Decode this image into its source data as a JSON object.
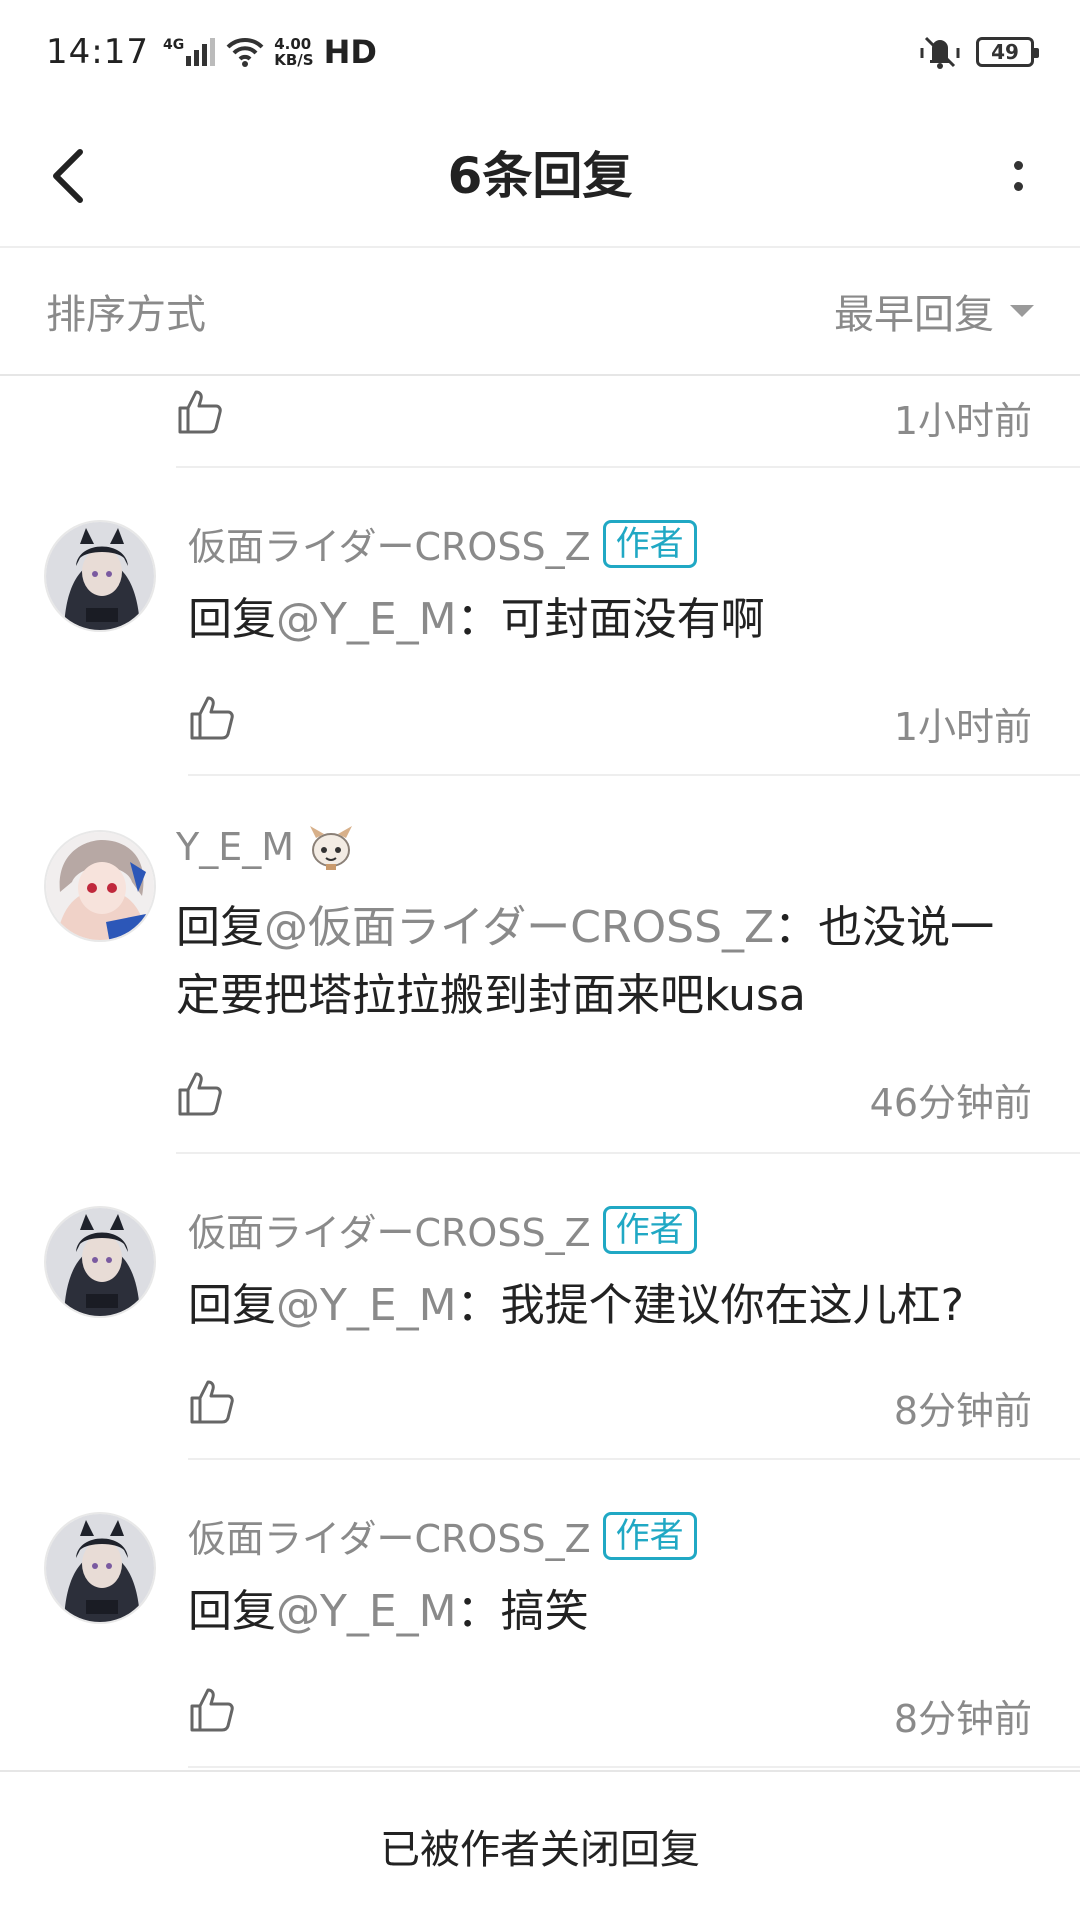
{
  "status_bar": {
    "time": "14:17",
    "network": "4G",
    "speed_value": "4.00",
    "speed_unit": "KB/S",
    "hd": "HD",
    "battery": "49"
  },
  "header": {
    "title": "6条回复"
  },
  "sort": {
    "label": "排序方式",
    "value": "最早回复"
  },
  "replies": [
    {
      "time": "1小时前"
    },
    {
      "username": "仮面ライダーCROSS_Z",
      "badge": "作者",
      "prefix": "回复",
      "mention": "@Y_E_M",
      "text": "：可封面没有啊",
      "time": "1小时前"
    },
    {
      "username": "Y_E_M",
      "prefix": "回复",
      "mention": "@仮面ライダーCROSS_Z",
      "text": "：也没说一定要把塔拉拉搬到封面来吧kusa",
      "time": "46分钟前"
    },
    {
      "username": "仮面ライダーCROSS_Z",
      "badge": "作者",
      "prefix": "回复",
      "mention": "@Y_E_M",
      "text": "：我提个建议你在这儿杠?",
      "time": "8分钟前"
    },
    {
      "username": "仮面ライダーCROSS_Z",
      "badge": "作者",
      "prefix": "回复",
      "mention": "@Y_E_M",
      "text": "：搞笑",
      "time": "8分钟前"
    }
  ],
  "footer": {
    "closed_text": "已被作者关闭回复"
  },
  "colors": {
    "accent": "#20a8c4",
    "muted_text": "#8a8a8a",
    "divider": "#eeeeee"
  }
}
